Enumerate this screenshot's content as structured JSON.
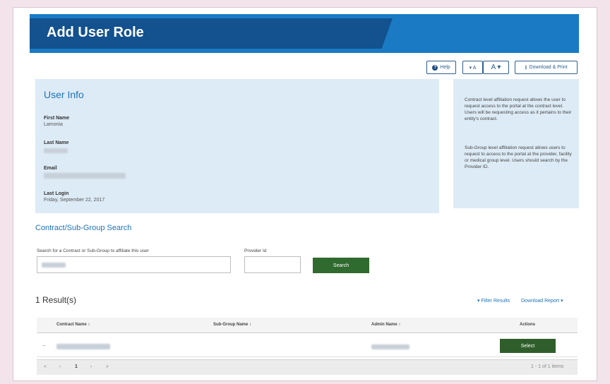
{
  "header": {
    "title": "Add User Role"
  },
  "toolbar": {
    "help_label": "Help",
    "font_decrease_label": "▾ A",
    "font_increase_label": "A ▾",
    "download_label": "Download & Print"
  },
  "user_info": {
    "title": "User Info",
    "first_name_label": "First Name",
    "first_name_value": "Lamonia",
    "last_name_label": "Last Name",
    "email_label": "Email",
    "last_login_label": "Last Login",
    "last_login_value": "Friday, September 22, 2017"
  },
  "info_box": {
    "paragraph1": "Contract level affiliation request allows the user to request access to the portal at the contract level. Users will be requesting access as it pertains to their entity's contract.",
    "paragraph2": "Sub-Group level affiliation request allows users to request to access to the portal at the provider, facility or medical group level. Users should search by the Provider ID."
  },
  "search": {
    "title": "Contract/Sub-Group Search",
    "contract_label": "Search for a Contract or Sub-Group to affiliate this user",
    "provider_label": "Provider Id",
    "button_label": "Search"
  },
  "results": {
    "title": "1 Result(s)",
    "filter_label": "Filter Results",
    "download_label": "Download Report",
    "columns": [
      "Contract Name",
      "Sub-Group Name",
      "Admin Name",
      "Actions"
    ],
    "row_toggle": "–",
    "select_label": "Select",
    "pager_first": "«",
    "pager_prev": "‹",
    "pager_page": "1",
    "pager_next": "›",
    "pager_last": "»",
    "pager_summary": "1 - 1 of 1 items"
  }
}
